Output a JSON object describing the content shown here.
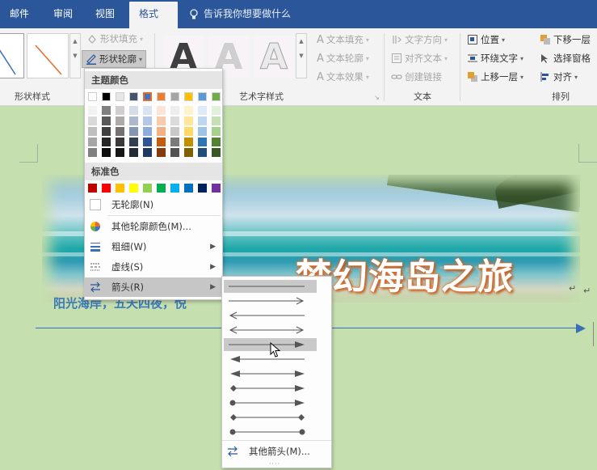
{
  "tabs": [
    {
      "label": "邮件",
      "active": false
    },
    {
      "label": "审阅",
      "active": false
    },
    {
      "label": "视图",
      "active": false
    },
    {
      "label": "格式",
      "active": true
    }
  ],
  "tell_me": "告诉我你想要做什么",
  "ribbon": {
    "shape_fill": "形状填充",
    "shape_outline": "形状轮廓",
    "shape_styles_label": "形状样式",
    "art_letter": "A",
    "text_fill": "文本填充",
    "text_outline": "文本轮廓",
    "text_effects": "文本效果",
    "art_styles_label": "艺术字样式",
    "text_direction": "文字方向",
    "align_text": "对齐文本",
    "create_link": "创建链接",
    "text_group_label": "文本",
    "position": "位置",
    "wrap_text": "环绕文字",
    "bring_forward": "上移一层",
    "send_backward": "下移一层",
    "selection_pane": "选择窗格",
    "align": "对齐",
    "arrange_label": "排列"
  },
  "outline_menu": {
    "theme_colors_header": "主题颜色",
    "standard_colors_header": "标准色",
    "no_outline": "无轮廓(N)",
    "more_colors": "其他轮廓颜色(M)...",
    "weight": "粗细(W)",
    "dashes": "虚线(S)",
    "arrows": "箭头(R)",
    "theme_top_row": [
      "#ffffff",
      "#000000",
      "#e7e6e6",
      "#44546a",
      "#4472c4",
      "#ed7d31",
      "#a5a5a5",
      "#ffc000",
      "#5b9bd5",
      "#70ad47"
    ],
    "theme_shades": [
      [
        "#f2f2f2",
        "#d9d9d9",
        "#bfbfbf",
        "#a6a6a6",
        "#808080"
      ],
      [
        "#7f7f7f",
        "#595959",
        "#404040",
        "#262626",
        "#0d0d0d"
      ],
      [
        "#d0cece",
        "#aeaaaa",
        "#757171",
        "#3a3838",
        "#171616"
      ],
      [
        "#d6dce5",
        "#adb9ca",
        "#8497b0",
        "#333f50",
        "#222a35"
      ],
      [
        "#dae3f3",
        "#b4c7e7",
        "#8faadc",
        "#2f5597",
        "#203864"
      ],
      [
        "#fbe5d6",
        "#f8cbad",
        "#f4b183",
        "#c55a11",
        "#843c0c"
      ],
      [
        "#ededed",
        "#dbdbdb",
        "#c9c9c9",
        "#7b7b7b",
        "#525252"
      ],
      [
        "#fff2cc",
        "#ffe699",
        "#ffd966",
        "#bf9000",
        "#7f6000"
      ],
      [
        "#deebf7",
        "#bdd7ee",
        "#9dc3e6",
        "#2e75b6",
        "#1f4e79"
      ],
      [
        "#e2f0d9",
        "#c5e0b4",
        "#a9d18e",
        "#548235",
        "#385723"
      ]
    ],
    "standard_colors": [
      "#c00000",
      "#ff0000",
      "#ffc000",
      "#ffff00",
      "#92d050",
      "#00b050",
      "#00b0f0",
      "#0070c0",
      "#002060",
      "#7030a0"
    ]
  },
  "arrow_menu": {
    "more_arrows": "其他箭头(M)..."
  },
  "document": {
    "title_art": "梦幻海岛之旅",
    "subtitle": "阳光海岸，五天四夜，悦",
    "return_mark": "↵"
  }
}
